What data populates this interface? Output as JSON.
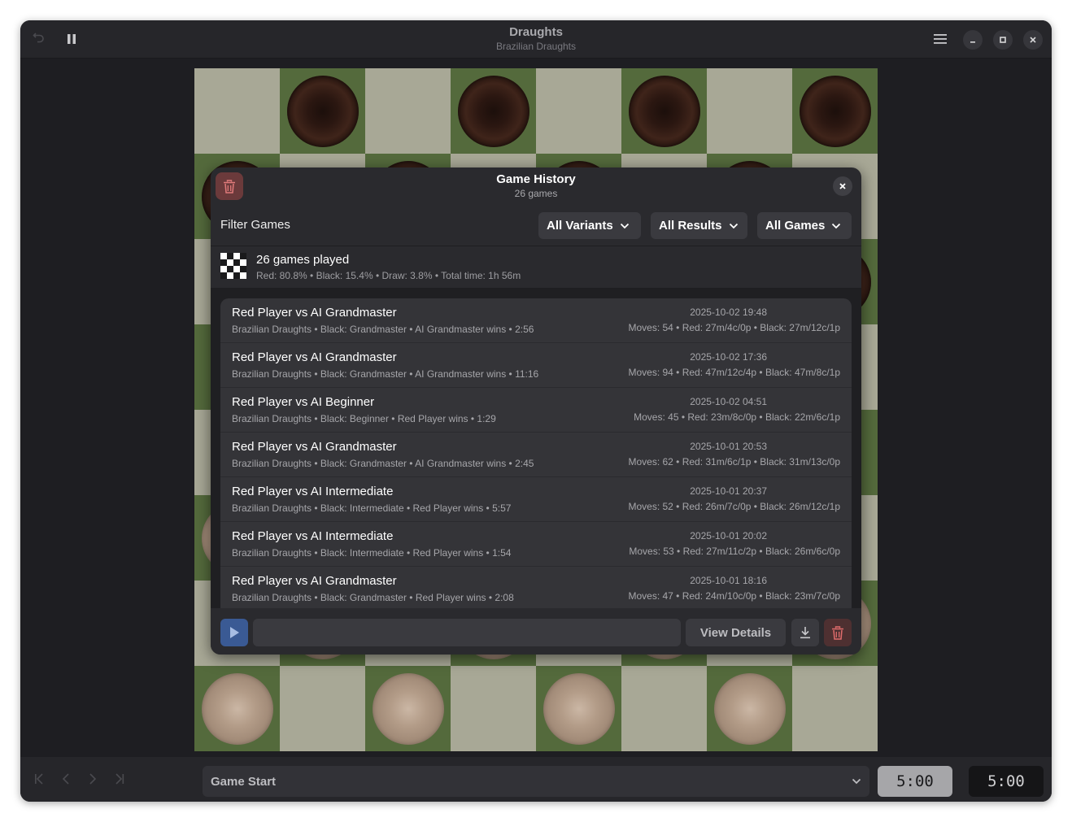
{
  "window": {
    "title": "Draughts",
    "subtitle": "Brazilian Draughts"
  },
  "dialog": {
    "title": "Game History",
    "subtitle": "26 games",
    "filter_label": "Filter Games",
    "filters": {
      "variants": "All Variants",
      "results": "All Results",
      "games": "All Games"
    },
    "stats": {
      "main": "26 games played",
      "sub": "Red: 80.8% • Black: 15.4% • Draw: 3.8% • Total time: 1h 56m"
    },
    "games": [
      {
        "title": "Red Player vs AI Grandmaster",
        "details": "Brazilian Draughts • Black: Grandmaster • AI Grandmaster wins • 2:56",
        "date": "2025-10-02 19:48",
        "moves": "Moves: 54 • Red: 27m/4c/0p • Black: 27m/12c/1p"
      },
      {
        "title": "Red Player vs AI Grandmaster",
        "details": "Brazilian Draughts • Black: Grandmaster • AI Grandmaster wins • 11:16",
        "date": "2025-10-02 17:36",
        "moves": "Moves: 94 • Red: 47m/12c/4p • Black: 47m/8c/1p"
      },
      {
        "title": "Red Player vs AI Beginner",
        "details": "Brazilian Draughts • Black: Beginner • Red Player wins • 1:29",
        "date": "2025-10-02 04:51",
        "moves": "Moves: 45 • Red: 23m/8c/0p • Black: 22m/6c/1p"
      },
      {
        "title": "Red Player vs AI Grandmaster",
        "details": "Brazilian Draughts • Black: Grandmaster • AI Grandmaster wins • 2:45",
        "date": "2025-10-01 20:53",
        "moves": "Moves: 62 • Red: 31m/6c/1p • Black: 31m/13c/0p"
      },
      {
        "title": "Red Player vs AI Intermediate",
        "details": "Brazilian Draughts • Black: Intermediate • Red Player wins • 5:57",
        "date": "2025-10-01 20:37",
        "moves": "Moves: 52 • Red: 26m/7c/0p • Black: 26m/12c/1p"
      },
      {
        "title": "Red Player vs AI Intermediate",
        "details": "Brazilian Draughts • Black: Intermediate • Red Player wins • 1:54",
        "date": "2025-10-01 20:02",
        "moves": "Moves: 53 • Red: 27m/11c/2p • Black: 26m/6c/0p"
      },
      {
        "title": "Red Player vs AI Grandmaster",
        "details": "Brazilian Draughts • Black: Grandmaster • Red Player wins • 2:08",
        "date": "2025-10-01 18:16",
        "moves": "Moves: 47 • Red: 24m/10c/0p • Black: 23m/7c/0p"
      }
    ],
    "view_details_label": "View Details"
  },
  "footer": {
    "move_select": "Game Start",
    "red_clock": "5:00",
    "black_clock": "5:00"
  },
  "colors": {
    "light_square": "#a8a896",
    "dark_square": "#546a3c",
    "accent_blue": "#3a5a94",
    "destructive": "#e06c6c"
  },
  "icons": {
    "undo": "undo-icon",
    "pause": "pause-icon",
    "menu": "hamburger-menu-icon",
    "minimize": "minimize-icon",
    "maximize": "maximize-icon",
    "close": "close-icon",
    "trash": "trash-icon",
    "play": "play-icon",
    "download": "download-icon",
    "chevron": "chevron-down-icon",
    "checker_board": "checkerboard-icon"
  }
}
